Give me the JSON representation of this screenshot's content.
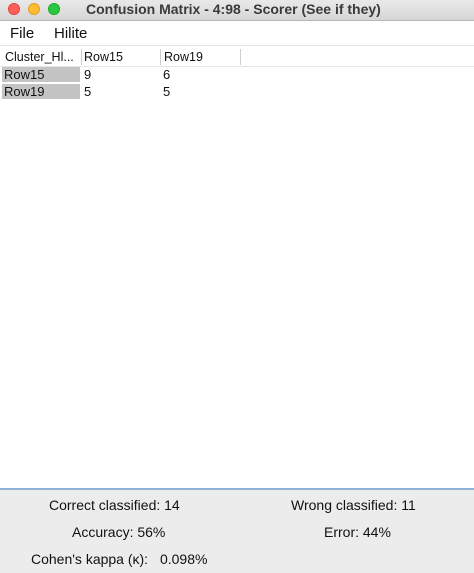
{
  "window": {
    "title": "Confusion Matrix - 4:98 - Scorer (See if they)",
    "colors": {
      "close": "#fe5f57",
      "minimize": "#febc2e",
      "maximize": "#28c840"
    }
  },
  "menu": {
    "file": "File",
    "hilite": "Hilite"
  },
  "table": {
    "headers": [
      "Cluster_Hl...",
      "Row15",
      "Row19"
    ],
    "rows": [
      {
        "label": "Row15",
        "cells": [
          "9",
          "6"
        ]
      },
      {
        "label": "Row19",
        "cells": [
          "5",
          "5"
        ]
      }
    ]
  },
  "stats": {
    "correct": "Correct classified: 14",
    "wrong": "Wrong classified: 11",
    "accuracy": "Accuracy: 56%",
    "error": "Error: 44%",
    "kappa_label": "Cohen's kappa (κ):",
    "kappa_value": "0.098%"
  }
}
